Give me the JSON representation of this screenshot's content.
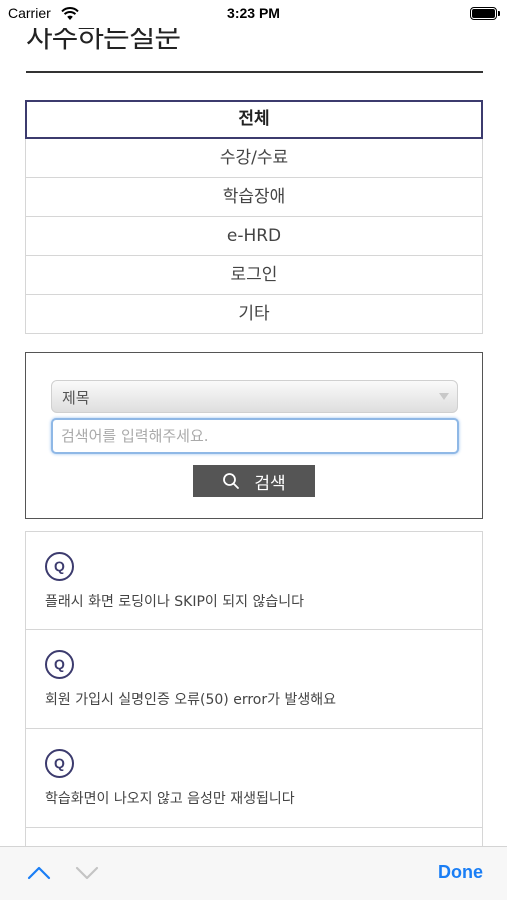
{
  "status_bar": {
    "carrier": "Carrier",
    "time": "3:23 PM"
  },
  "page": {
    "title": "자주하는질문"
  },
  "categories": [
    {
      "label": "전체",
      "active": true
    },
    {
      "label": "수강/수료",
      "active": false
    },
    {
      "label": "학습장애",
      "active": false
    },
    {
      "label": "e-HRD",
      "active": false
    },
    {
      "label": "로그인",
      "active": false
    },
    {
      "label": "기타",
      "active": false
    }
  ],
  "search": {
    "select_value": "제목",
    "placeholder": "검색어를 입력해주세요.",
    "button_label": "검색"
  },
  "faq": {
    "badge": "Q",
    "items": [
      {
        "question": "플래시 화면 로딩이나 SKIP이 되지 않습니다"
      },
      {
        "question": "회원 가입시 실명인증 오류(50) error가 발생해요"
      },
      {
        "question": "학습화면이 나오지 않고 음성만 재생됩니다"
      }
    ]
  },
  "toolbar": {
    "done_label": "Done"
  },
  "colors": {
    "accent": "#3c3b6e",
    "ios_blue": "#1a7ef5",
    "button_gray": "#555555",
    "input_focus": "#8fb8e6"
  },
  "icons": {
    "wifi": "wifi-icon",
    "battery": "battery-icon",
    "search": "search-icon",
    "prev": "chevron-up-icon",
    "next": "chevron-down-icon"
  }
}
